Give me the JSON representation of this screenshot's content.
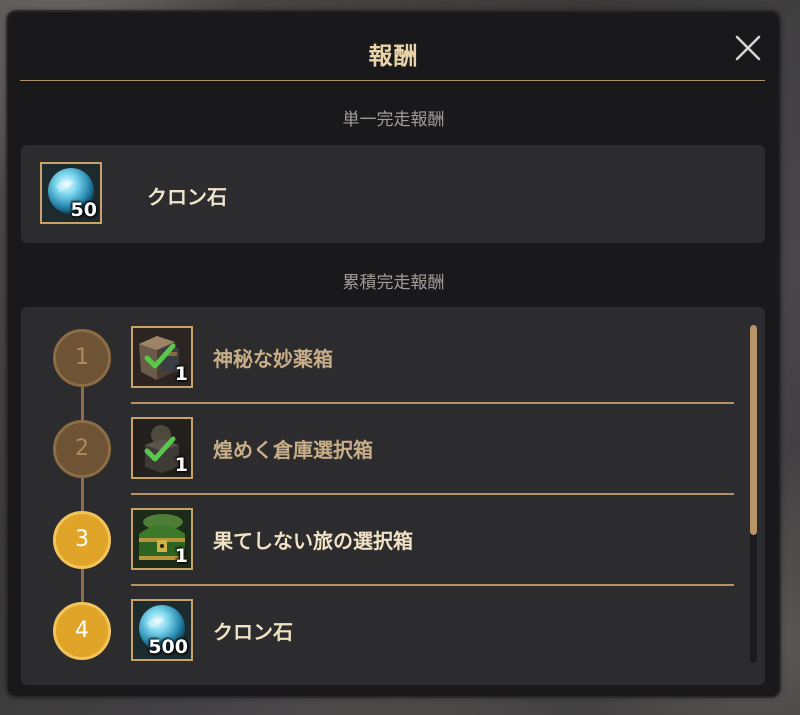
{
  "dialog": {
    "title": "報酬",
    "close_icon": "close-icon"
  },
  "single_reward": {
    "section_label": "単一完走報酬",
    "item": {
      "name": "クロン石",
      "quantity": "50",
      "icon": "kron-stone-icon"
    }
  },
  "cumulative_rewards": {
    "section_label": "累積完走報酬",
    "items": [
      {
        "step": "1",
        "name": "神秘な妙薬箱",
        "quantity": "1",
        "icon": "mystic-potion-box-icon",
        "claimed": true
      },
      {
        "step": "2",
        "name": "煌めく倉庫選択箱",
        "quantity": "1",
        "icon": "warehouse-selection-box-icon",
        "claimed": true
      },
      {
        "step": "3",
        "name": "果てしない旅の選択箱",
        "quantity": "1",
        "icon": "journey-selection-chest-icon",
        "claimed": false
      },
      {
        "step": "4",
        "name": "クロン石",
        "quantity": "500",
        "icon": "kron-stone-icon",
        "claimed": false
      }
    ]
  },
  "colors": {
    "accent_gold": "#e0a528",
    "claimed_bronze": "#6e5434",
    "text_claimed": "#c8ae88",
    "text_active": "#f0e2c4"
  }
}
